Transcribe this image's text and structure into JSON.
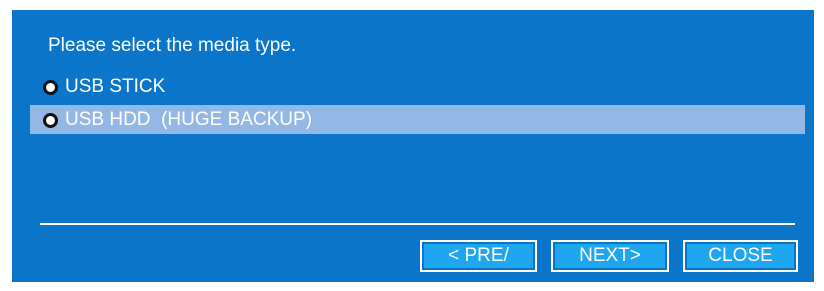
{
  "dialog": {
    "prompt": "Please select the media type.",
    "options": [
      {
        "label": "USB STICK",
        "selected": false
      },
      {
        "label": "USB HDD  (HUGE BACKUP)",
        "selected": true
      }
    ],
    "buttons": {
      "pre": "< PRE/",
      "next": "NEXT>",
      "close": "CLOSE"
    }
  },
  "colors": {
    "dialog_background": "#0a75c9",
    "highlight": "#94b8e6",
    "button_fill": "#1ea6ee",
    "text": "#ffffff"
  }
}
